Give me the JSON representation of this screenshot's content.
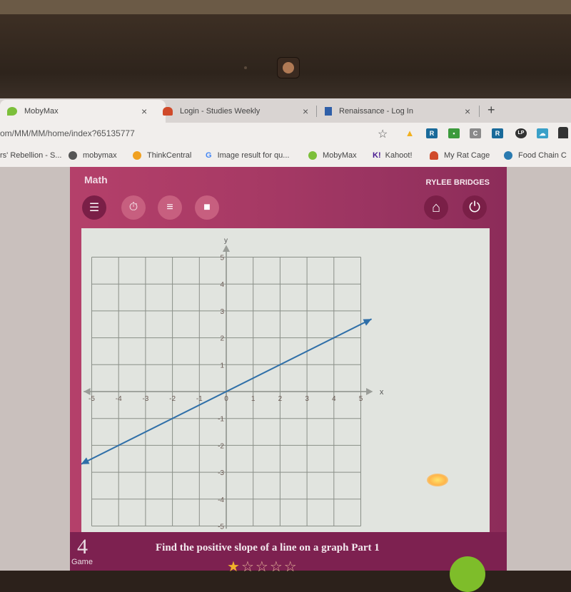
{
  "browser": {
    "tabs": [
      {
        "title": "MobyMax",
        "active": true,
        "close": "×"
      },
      {
        "title": "Login - Studies Weekly",
        "active": false,
        "close": "×"
      },
      {
        "title": "Renaissance - Log In",
        "active": false,
        "close": "×"
      }
    ],
    "new_tab": "+",
    "url": "om/MM/MM/home/index?65135777",
    "star": "☆",
    "extensions": [
      {
        "name": "drive-icon",
        "label": "▲",
        "color": "#f2b01e"
      },
      {
        "name": "renaissance-ext-icon",
        "label": "R",
        "color": "#1a6a9a"
      },
      {
        "name": "classroom-ext-icon",
        "label": "▪",
        "color": "#3c9a3c"
      },
      {
        "name": "c-ext-icon",
        "label": "C",
        "color": "#8a8a8a"
      },
      {
        "name": "renaissance-ext-2-icon",
        "label": "R",
        "color": "#1a6a9a"
      },
      {
        "name": "lp-ext-icon",
        "label": "LP",
        "color": "#333333"
      },
      {
        "name": "cloud-ext-icon",
        "label": "☁",
        "color": "#3aa0c8"
      }
    ],
    "bookmarks": [
      {
        "label": "rs' Rebellion - S...",
        "icon": "none"
      },
      {
        "label": "mobymax",
        "icon": "globe-icon",
        "color": "#555555"
      },
      {
        "label": "ThinkCentral",
        "icon": "circle-icon",
        "color": "#f0a020"
      },
      {
        "label": "Image result for qu...",
        "icon": "google-icon",
        "color": "#4285f4"
      },
      {
        "label": "MobyMax",
        "icon": "mobymax-icon",
        "color": "#7cbf3a"
      },
      {
        "label": "Kahoot!",
        "icon": "kahoot-icon",
        "color": "#46178f"
      },
      {
        "label": "My Rat Cage",
        "icon": "rat-cage-icon",
        "color": "#d04a2a"
      },
      {
        "label": "Food Chain C",
        "icon": "earth-icon",
        "color": "#2a7ab0"
      }
    ]
  },
  "app": {
    "subject": "Math",
    "user_name": "RYLEE BRIDGES",
    "toolbar": {
      "menu": "☰",
      "timer": "⏱",
      "list": "≡",
      "video": "■",
      "home": "⌂",
      "power": "⏻"
    },
    "footer": {
      "game_number": "4",
      "game_label": "Game",
      "lesson_title": "Find the positive slope of a line on a graph Part 1",
      "stars_filled": 1,
      "stars_total": 5,
      "star_on": "★",
      "star_off": "☆"
    }
  },
  "chart_data": {
    "type": "line",
    "title": "",
    "xlabel": "x",
    "ylabel": "y",
    "xlim": [
      -5,
      5
    ],
    "ylim": [
      -5,
      5
    ],
    "grid": true,
    "x_ticks": [
      -5,
      -4,
      -3,
      -2,
      -1,
      0,
      1,
      2,
      3,
      4,
      5
    ],
    "y_ticks": [
      -5,
      -4,
      -3,
      -2,
      -1,
      1,
      2,
      3,
      4,
      5
    ],
    "series": [
      {
        "name": "line",
        "color": "#2f6fa8",
        "slope": 0.5,
        "intercept": 0,
        "x": [
          -5.4,
          5.4
        ],
        "y": [
          -2.7,
          2.7
        ],
        "arrows": "both"
      }
    ]
  }
}
